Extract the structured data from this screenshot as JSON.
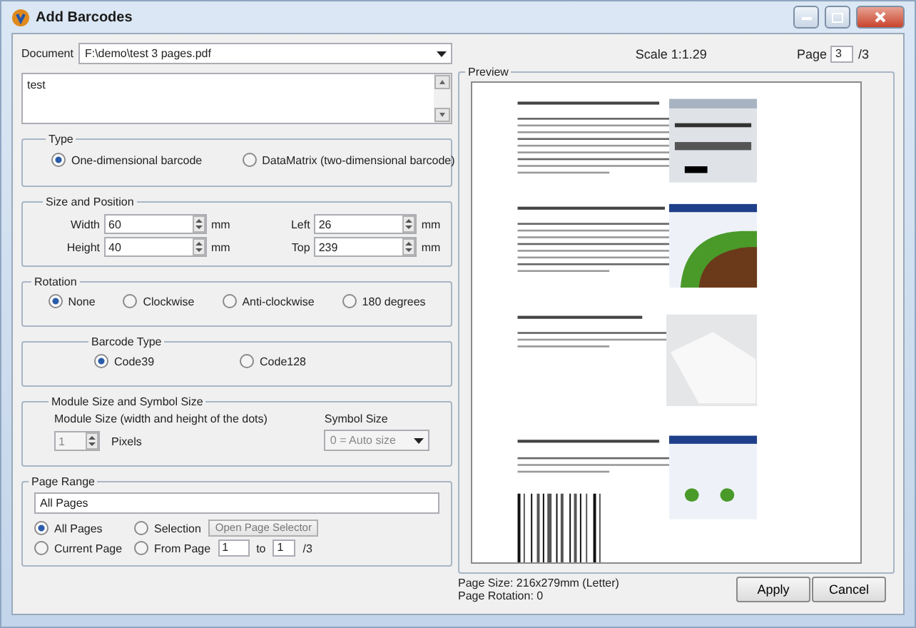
{
  "window": {
    "title": "Add Barcodes"
  },
  "document": {
    "label": "Document",
    "value": "F:\\demo\\test 3 pages.pdf"
  },
  "barcode_text": {
    "value": "test"
  },
  "type_group": {
    "title": "Type",
    "options": [
      {
        "label": "One-dimensional barcode",
        "selected": true
      },
      {
        "label": "DataMatrix (two-dimensional barcode)",
        "selected": false
      }
    ]
  },
  "size_position": {
    "title": "Size and Position",
    "fields": [
      {
        "label": "Width",
        "value": "60",
        "unit": "mm"
      },
      {
        "label": "Left",
        "value": "26",
        "unit": "mm"
      },
      {
        "label": "Height",
        "value": "40",
        "unit": "mm"
      },
      {
        "label": "Top",
        "value": "239",
        "unit": "mm"
      }
    ]
  },
  "rotation": {
    "title": "Rotation",
    "options": [
      {
        "label": "None",
        "selected": true
      },
      {
        "label": "Clockwise",
        "selected": false
      },
      {
        "label": "Anti-clockwise",
        "selected": false
      },
      {
        "label": "180 degrees",
        "selected": false
      }
    ]
  },
  "barcode_type": {
    "title": "Barcode Type",
    "options": [
      {
        "label": "Code39",
        "selected": true
      },
      {
        "label": "Code128",
        "selected": false
      }
    ]
  },
  "module_symbol": {
    "title": "Module Size and Symbol Size",
    "module_label": "Module Size (width and height of the dots)",
    "module_value": "1",
    "module_unit": "Pixels",
    "symbol_label": "Symbol Size",
    "symbol_value": "0 = Auto size",
    "disabled": true
  },
  "page_range": {
    "title": "Page Range",
    "value": "All Pages",
    "options": [
      {
        "label": "All Pages",
        "selected": true,
        "kind": "plain"
      },
      {
        "label": "Selection",
        "selected": false,
        "kind": "selection"
      },
      {
        "label": "Current Page",
        "selected": false,
        "kind": "plain"
      },
      {
        "label": "From Page",
        "selected": false,
        "kind": "range"
      }
    ],
    "selector_button": "Open Page Selector",
    "from": "1",
    "to_label": "to",
    "to": "1",
    "total": "/3"
  },
  "preview": {
    "scale": "Scale 1:1.29",
    "page_label": "Page",
    "page": "3",
    "page_total": "/3",
    "title": "Preview",
    "page_size": "Page Size: 216x279mm (Letter)",
    "page_rotation": "Page Rotation: 0"
  },
  "buttons": [
    {
      "label": "Apply"
    },
    {
      "label": "Cancel"
    }
  ]
}
